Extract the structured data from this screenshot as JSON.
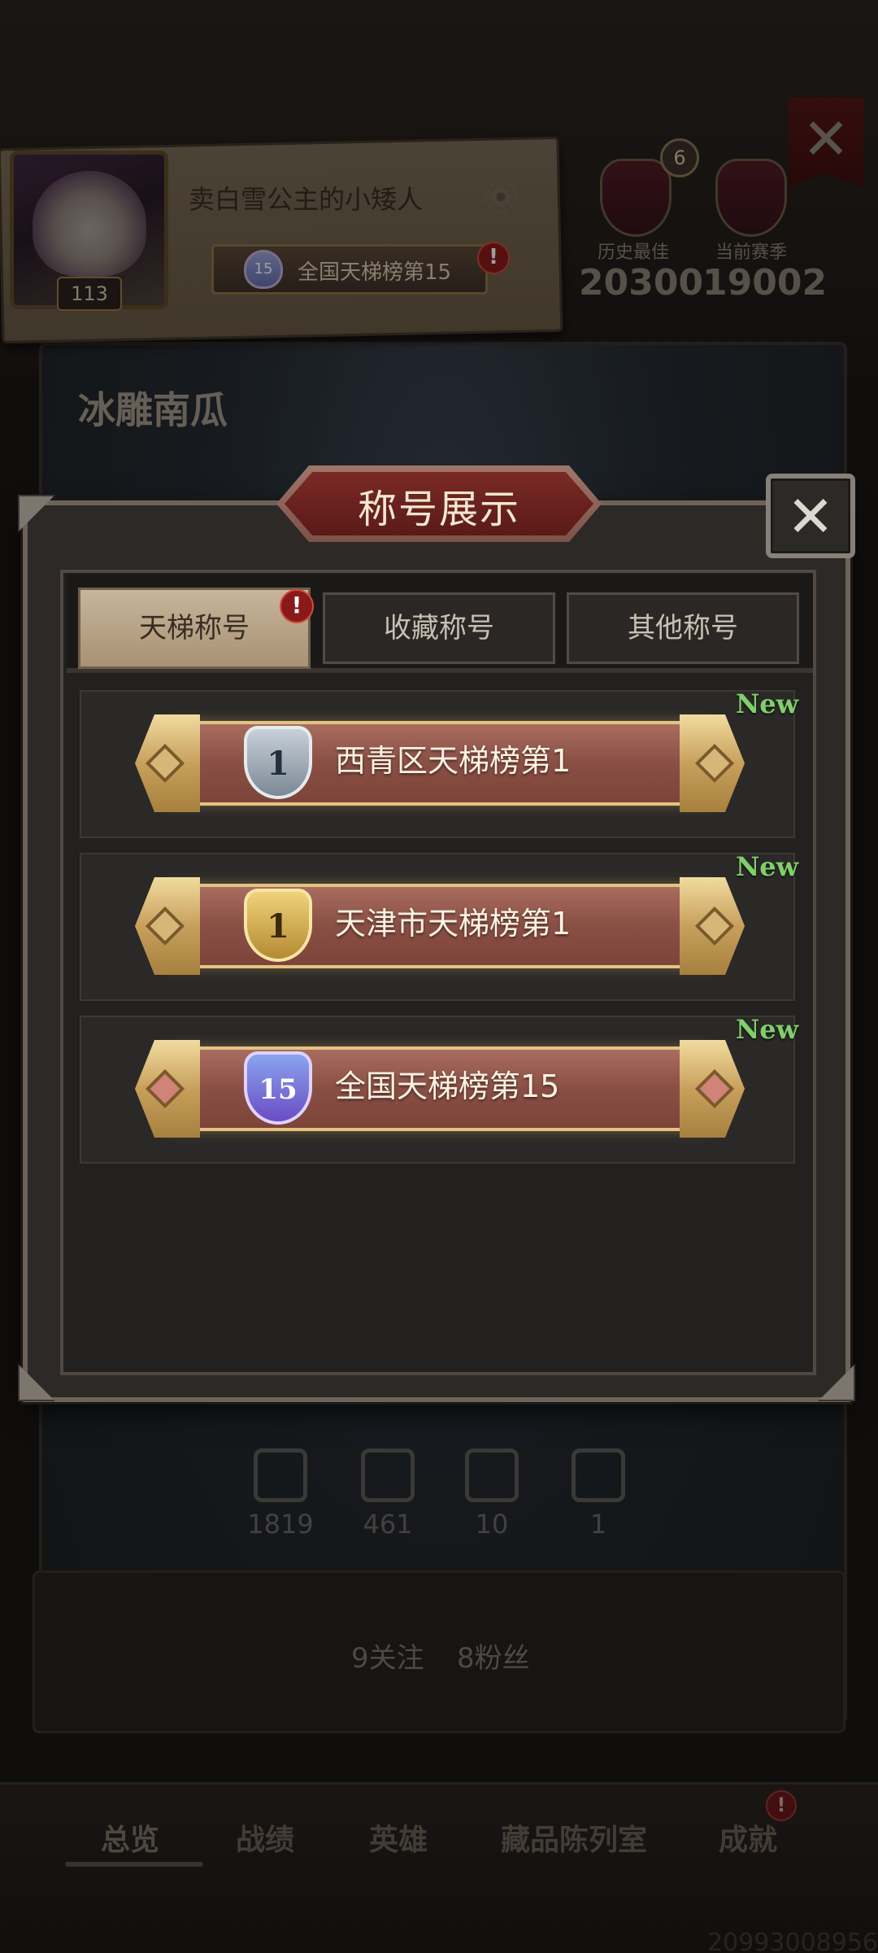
{
  "player": {
    "name": "卖白雪公主的小矮人",
    "level": "113",
    "title_badge": {
      "emblem_number": "15",
      "text": "全国天梯榜第15",
      "alert": "!"
    }
  },
  "rank": {
    "crown_count": "6",
    "best_label": "历史最佳",
    "season_label": "当前赛季",
    "best_score": "20300",
    "season_score": "19002"
  },
  "top_close_icon": "close-icon",
  "background": {
    "nickname": "冰雕南瓜",
    "stats": [
      {
        "icon": "crossed-swords-icon",
        "value": "1819"
      },
      {
        "icon": "crown-icon",
        "value": "461"
      },
      {
        "icon": "card-icon",
        "value": "10"
      },
      {
        "icon": "checkerboard-icon",
        "value": "1"
      }
    ],
    "follow_text": "9关注",
    "fans_text": "8粉丝"
  },
  "modal": {
    "title": "称号展示",
    "close_glyph": "✕",
    "tabs": [
      {
        "label": "天梯称号",
        "active": true,
        "alert": "!"
      },
      {
        "label": "收藏称号",
        "active": false
      },
      {
        "label": "其他称号",
        "active": false
      }
    ],
    "titles": [
      {
        "emblem_number": "1",
        "emblem_style": "silver",
        "text": "西青区天梯榜第1",
        "new_label": "New"
      },
      {
        "emblem_number": "1",
        "emblem_style": "gold",
        "text": "天津市天梯榜第1",
        "new_label": "New"
      },
      {
        "emblem_number": "15",
        "emblem_style": "purple",
        "text": "全国天梯榜第15",
        "new_label": "New"
      }
    ]
  },
  "bottom_tabs": {
    "overview": "总览",
    "record": "战绩",
    "heroes": "英雄",
    "collection": "藏品陈列室",
    "achievements": "成就",
    "achievements_alert": "!"
  },
  "footer_id": "20993008956",
  "colors": {
    "accent_gold": "#e3c382",
    "banner_red": "#8a4f44",
    "new_green": "#7fcf6a",
    "alert_red": "#8a1a1a"
  }
}
